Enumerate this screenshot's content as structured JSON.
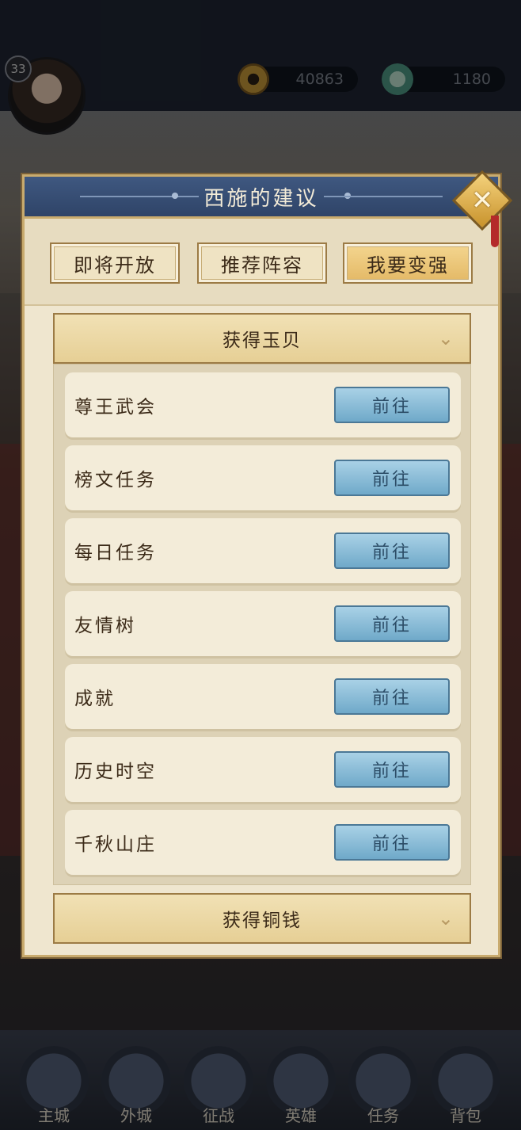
{
  "player": {
    "level": "33"
  },
  "resources": [
    {
      "icon": "copper-coin-icon",
      "value": "40863"
    },
    {
      "icon": "jade-icon",
      "value": "1180"
    }
  ],
  "dialog": {
    "title": "西施的建议",
    "tabs": [
      {
        "label": "即将开放",
        "active": false
      },
      {
        "label": "推荐阵容",
        "active": false
      },
      {
        "label": "我要变强",
        "active": true
      }
    ],
    "sections": [
      {
        "title": "获得玉贝",
        "expanded": true,
        "items": [
          {
            "label": "尊王武会",
            "button": "前往"
          },
          {
            "label": "榜文任务",
            "button": "前往"
          },
          {
            "label": "每日任务",
            "button": "前往"
          },
          {
            "label": "友情树",
            "button": "前往"
          },
          {
            "label": "成就",
            "button": "前往"
          },
          {
            "label": "历史时空",
            "button": "前往"
          },
          {
            "label": "千秋山庄",
            "button": "前往"
          }
        ]
      },
      {
        "title": "获得铜钱",
        "expanded": false
      }
    ]
  },
  "bottom_nav": [
    {
      "label": "主城"
    },
    {
      "label": "外城"
    },
    {
      "label": "征战"
    },
    {
      "label": "英雄"
    },
    {
      "label": "任务"
    },
    {
      "label": "背包"
    }
  ],
  "colors": {
    "accent_gold": "#e3b865",
    "button_blue": "#6fa9c9",
    "header_blue": "#2f4468"
  }
}
